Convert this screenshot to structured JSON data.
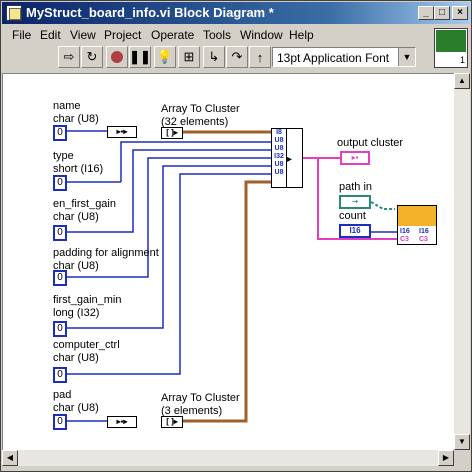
{
  "window": {
    "title": "MyStruct_board_info.vi Block Diagram *",
    "buttons": {
      "minimize": "_",
      "maximize": "□",
      "close": "×"
    }
  },
  "menu": [
    "File",
    "Edit",
    "View",
    "Project",
    "Operate",
    "Tools",
    "Window",
    "Help"
  ],
  "toolbar": {
    "font_select": "13pt Application Font",
    "icons": [
      "run-arrow-icon",
      "run-continuous-icon",
      "abort-icon",
      "pause-icon",
      "highlight-execution-icon",
      "retain-wire-values-icon",
      "step-into-icon",
      "step-over-icon",
      "step-out-icon"
    ]
  },
  "connector_pane": {
    "label": "1"
  },
  "controls": [
    {
      "name": "name",
      "type": "char (U8)",
      "value": "0"
    },
    {
      "name": "type",
      "type": "short (I16)",
      "value": "0"
    },
    {
      "name": "en_first_gain",
      "type": "char (U8)",
      "value": "0"
    },
    {
      "name": "padding for alignment",
      "type": "char (U8)",
      "value": "0"
    },
    {
      "name": "first_gain_min",
      "type": "long (I32)",
      "value": "0"
    },
    {
      "name": "computer_ctrl",
      "type": "char (U8)",
      "value": "0"
    },
    {
      "name": "pad",
      "type": "char (U8)",
      "value": "0"
    }
  ],
  "nodes": {
    "array_to_cluster_1": {
      "label": "Array To Cluster",
      "sub": "(32 elements)"
    },
    "array_to_cluster_2": {
      "label": "Array To Cluster",
      "sub": "(3 elements)"
    },
    "bundle_terms": [
      "I8",
      "U8",
      "U8",
      "I32",
      "U8",
      "U8"
    ],
    "output_cluster": "output cluster",
    "path_in": "path in",
    "count": "count",
    "count_value": "I16",
    "write_terms": [
      "I16",
      "I16",
      "C3",
      "C3"
    ]
  },
  "colors": {
    "wire_blue": "#1a2fbf",
    "wire_brown": "#a0602a",
    "wire_pink": "#e040c0",
    "wire_green": "#2a8a7a"
  }
}
